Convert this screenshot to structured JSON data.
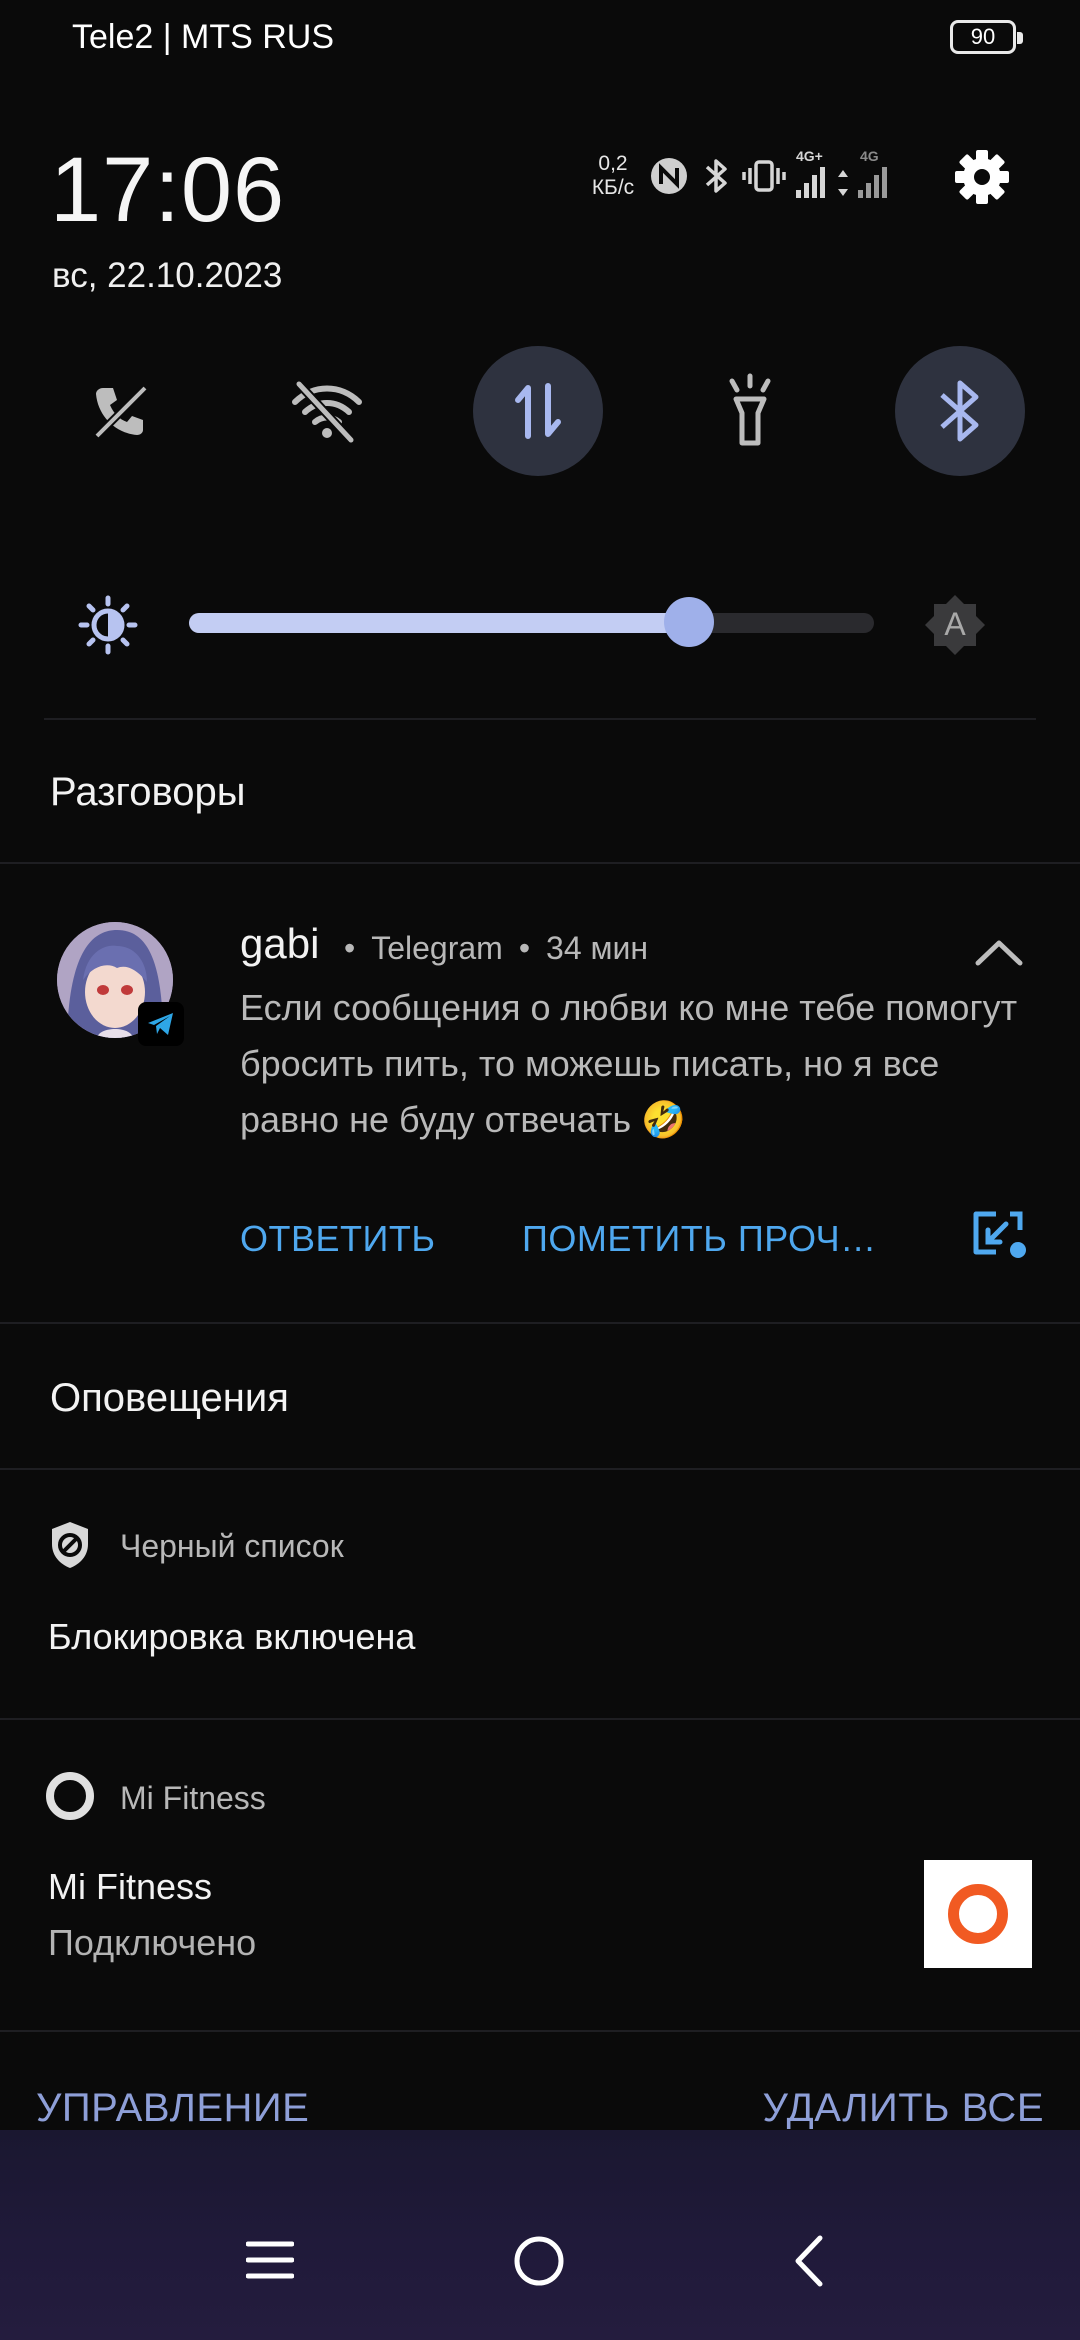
{
  "status_bar": {
    "carrier": "Tele2 | MTS RUS",
    "battery": "90"
  },
  "header": {
    "time": "17:06",
    "date": "вс, 22.10.2023",
    "net_speed_value": "0,2",
    "net_speed_unit": "КБ/с",
    "sim1_label": "4G+",
    "sim2_label": "4G"
  },
  "quick_toggles": [
    {
      "name": "call-off",
      "active": false
    },
    {
      "name": "wifi-off",
      "active": false
    },
    {
      "name": "mobile-data",
      "active": true
    },
    {
      "name": "flashlight",
      "active": false
    },
    {
      "name": "bluetooth",
      "active": true
    }
  ],
  "brightness": {
    "level": 0.73,
    "auto_label": "A"
  },
  "conversations": {
    "title": "Разговоры",
    "items": [
      {
        "sender": "gabi",
        "app": "Telegram",
        "time": "34 мин",
        "message": "Если сообщения о любви ко мне тебе помогут бросить пить, то можешь писать, но я все равно не буду отвечать 🤣",
        "actions": [
          "ОТВЕТИТЬ",
          "ПОМЕТИТЬ ПРОЧ…"
        ]
      }
    ]
  },
  "notifications": {
    "title": "Оповещения",
    "items": [
      {
        "app": "Черный список",
        "title": "Блокировка включена"
      },
      {
        "app": "Mi Fitness",
        "title": "Mi Fitness",
        "text": "Подключено"
      }
    ]
  },
  "footer": {
    "manage": "УПРАВЛЕНИЕ",
    "clear_all": "УДАЛИТЬ ВСЕ"
  },
  "colors": {
    "accent_blue": "#4fa8ef",
    "slider_fill": "#c3cdf3",
    "footer_text": "#8e9fd8",
    "toggle_active_bg": "#2e323f"
  }
}
